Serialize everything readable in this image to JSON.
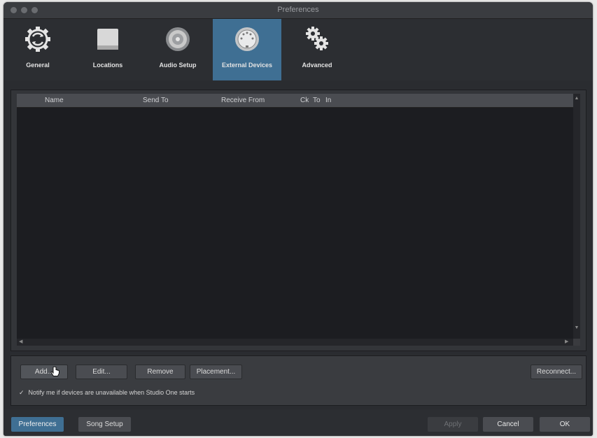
{
  "window": {
    "title": "Preferences"
  },
  "toolbar": {
    "items": [
      {
        "label": "General",
        "icon": "general-gear-icon",
        "active": false
      },
      {
        "label": "Locations",
        "icon": "drive-icon",
        "active": false
      },
      {
        "label": "Audio Setup",
        "icon": "speaker-icon",
        "active": false
      },
      {
        "label": "External Devices",
        "icon": "midi-connector-icon",
        "active": true
      },
      {
        "label": "Advanced",
        "icon": "gears-icon",
        "active": false
      }
    ]
  },
  "device_list": {
    "columns": [
      "Name",
      "Send To",
      "Receive From",
      "Ck",
      "To",
      "In"
    ],
    "rows": []
  },
  "actions": {
    "add": "Add...",
    "edit": "Edit...",
    "remove": "Remove",
    "placement": "Placement...",
    "reconnect": "Reconnect...",
    "notify_label": "Notify me if devices are unavailable when Studio One starts",
    "notify_checked": true
  },
  "footer": {
    "preferences": "Preferences",
    "song_setup": "Song Setup",
    "apply": "Apply",
    "cancel": "Cancel",
    "ok": "OK"
  },
  "colors": {
    "accent": "#3f6f93",
    "background": "#2a2c30"
  }
}
